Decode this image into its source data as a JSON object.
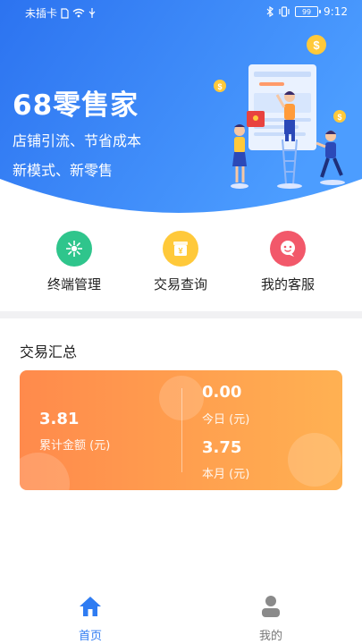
{
  "status_bar": {
    "carrier": "未插卡",
    "time": "9:12",
    "battery": "99"
  },
  "hero": {
    "brand": "68零售家",
    "slogan_line1": "店铺引流、节省成本",
    "slogan_line2": "新模式、新零售"
  },
  "actions": [
    {
      "label": "终端管理",
      "icon": "terminal-hub-icon",
      "color": "#2fc58c"
    },
    {
      "label": "交易查询",
      "icon": "yuan-ledger-icon",
      "color": "#ffc93a"
    },
    {
      "label": "我的客服",
      "icon": "customer-service-icon",
      "color": "#f2586a"
    }
  ],
  "summary": {
    "title": "交易汇总",
    "total": {
      "value": "3.81",
      "label": "累计金额 (元)"
    },
    "today": {
      "value": "0.00",
      "label": "今日 (元)"
    },
    "month": {
      "value": "3.75",
      "label": "本月 (元)"
    }
  },
  "tabbar": {
    "home": "首页",
    "mine": "我的",
    "active_color": "#2f7cf2"
  }
}
